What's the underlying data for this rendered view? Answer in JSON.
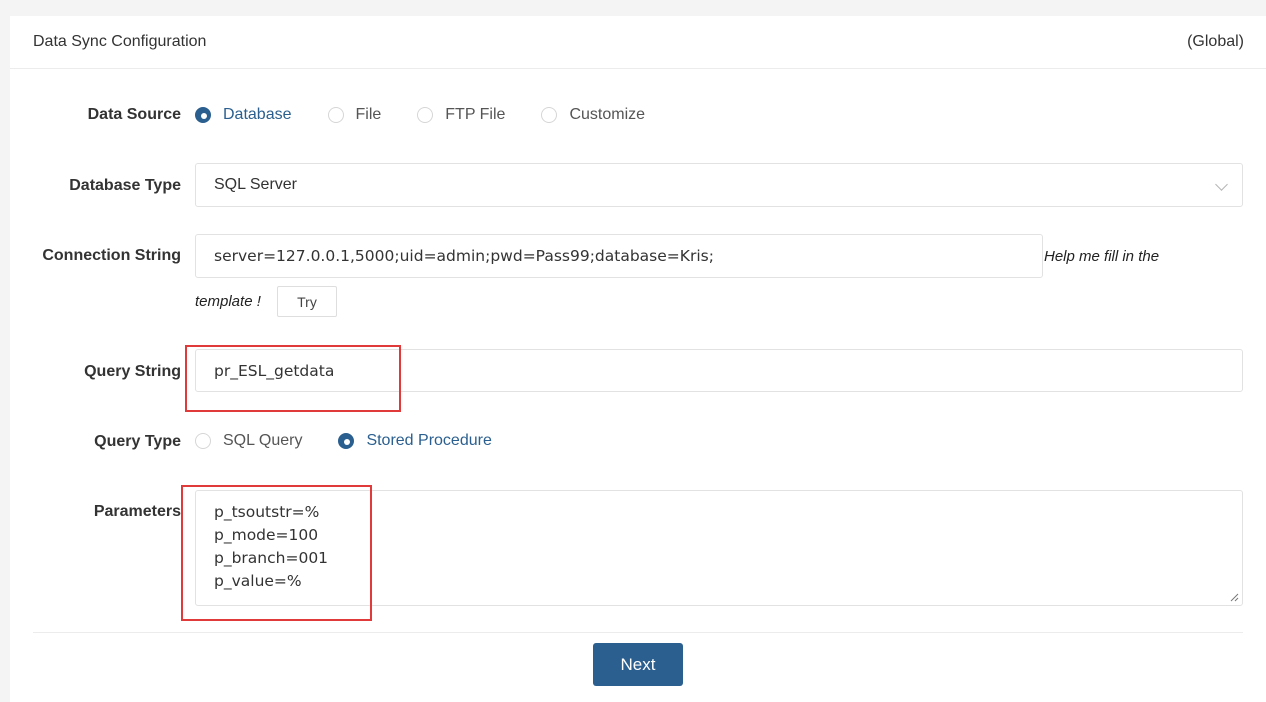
{
  "header": {
    "title": "Data Sync Configuration",
    "scope": "(Global)"
  },
  "data_source": {
    "label": "Data Source",
    "options": [
      "Database",
      "File",
      "FTP File",
      "Customize"
    ],
    "selected": "Database"
  },
  "database_type": {
    "label": "Database Type",
    "value": "SQL Server"
  },
  "connection_string": {
    "label": "Connection String",
    "value": "server=127.0.0.1,5000;uid=admin;pwd=Pass99;database=Kris;",
    "help_line1": "Help me fill in the",
    "help_line2": "template !",
    "try_label": "Try"
  },
  "query_string": {
    "label": "Query String",
    "value": "pr_ESL_getdata"
  },
  "query_type": {
    "label": "Query Type",
    "options": [
      "SQL Query",
      "Stored Procedure"
    ],
    "selected": "Stored Procedure"
  },
  "parameters": {
    "label": "Parameters",
    "lines": [
      "p_tsoutstr=%",
      "p_mode=100",
      "p_branch=001",
      "p_value=%"
    ]
  },
  "footer": {
    "next_label": "Next"
  },
  "colors": {
    "accent": "#2a5f8f",
    "highlight": "#e03a3a"
  }
}
